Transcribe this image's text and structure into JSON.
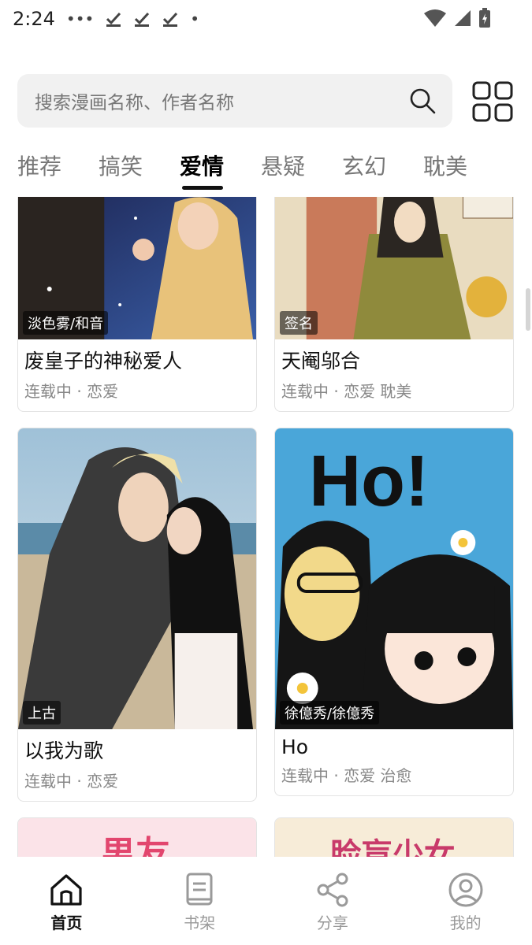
{
  "status_bar": {
    "time": "2:24",
    "dots": "•••",
    "dot_single": "•"
  },
  "search": {
    "placeholder": "搜索漫画名称、作者名称"
  },
  "tabs": [
    {
      "label": "推荐"
    },
    {
      "label": "搞笑"
    },
    {
      "label": "爱情",
      "active": true
    },
    {
      "label": "悬疑"
    },
    {
      "label": "玄幻"
    },
    {
      "label": "耽美"
    }
  ],
  "cards": [
    {
      "author": "淡色雾/和音",
      "title": "废皇子的神秘爱人",
      "meta": "连载中 · 恋爱"
    },
    {
      "author": "签名",
      "title": "天阉邬合",
      "meta": "连载中 · 恋爱 耽美"
    },
    {
      "author": "上古",
      "title": "以我为歌",
      "meta": "连载中 · 恋爱"
    },
    {
      "author": "徐億秀/徐億秀",
      "title": "Ho",
      "meta": "连载中 · 恋爱 治愈"
    },
    {
      "cover_text": "男友"
    },
    {
      "cover_text": "脸盲少女"
    }
  ],
  "cover_art": {
    "ho_logo": "Ho!"
  },
  "bottom_nav": [
    {
      "label": "首页",
      "icon": "home-icon",
      "active": true
    },
    {
      "label": "书架",
      "icon": "bookshelf-icon"
    },
    {
      "label": "分享",
      "icon": "share-icon"
    },
    {
      "label": "我的",
      "icon": "profile-icon"
    }
  ]
}
